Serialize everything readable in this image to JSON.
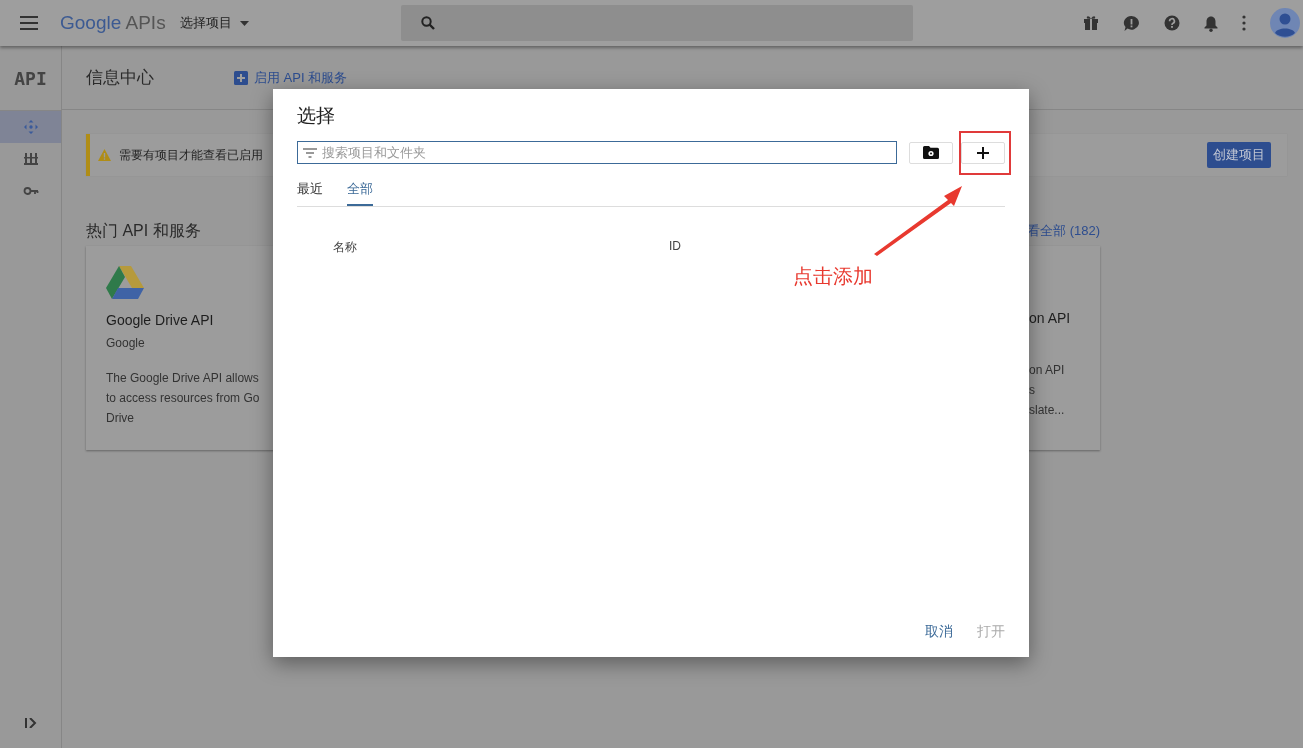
{
  "top_bar": {
    "logo": {
      "brand": "Google",
      "product": "APIs"
    },
    "project_picker": "选择项目"
  },
  "sidebar": {
    "title": "API",
    "items": [
      {
        "kind": "dashboard",
        "selected": true
      },
      {
        "kind": "library",
        "selected": false
      },
      {
        "kind": "credentials",
        "selected": false
      }
    ]
  },
  "header": {
    "title": "信息中心",
    "action": "启用 API 和服务"
  },
  "banner": {
    "message": "需要有项目才能查看已启用",
    "button": "创建项目"
  },
  "section": {
    "title": "热门 API 和服务",
    "view_all": "看全部 (182)"
  },
  "cards": [
    {
      "name": "Google Drive API",
      "vendor": "Google",
      "description_lines": [
        "The Google Drive API allows",
        "to access resources from Go",
        "Drive"
      ]
    },
    {
      "name": "on API",
      "description_lines": [
        "on API",
        "s",
        "slate..."
      ]
    }
  ],
  "dialog": {
    "title": "选择",
    "search": {
      "placeholder": "搜索项目和文件夹"
    },
    "tabs": [
      {
        "label": "最近",
        "selected": false
      },
      {
        "label": "全部",
        "selected": true
      }
    ],
    "table": {
      "columns": [
        "名称",
        "ID"
      ]
    },
    "buttons": [
      {
        "label": "取消",
        "disabled": false
      },
      {
        "label": "打开",
        "disabled": true
      }
    ]
  },
  "annotation": {
    "label": "点击添加"
  }
}
